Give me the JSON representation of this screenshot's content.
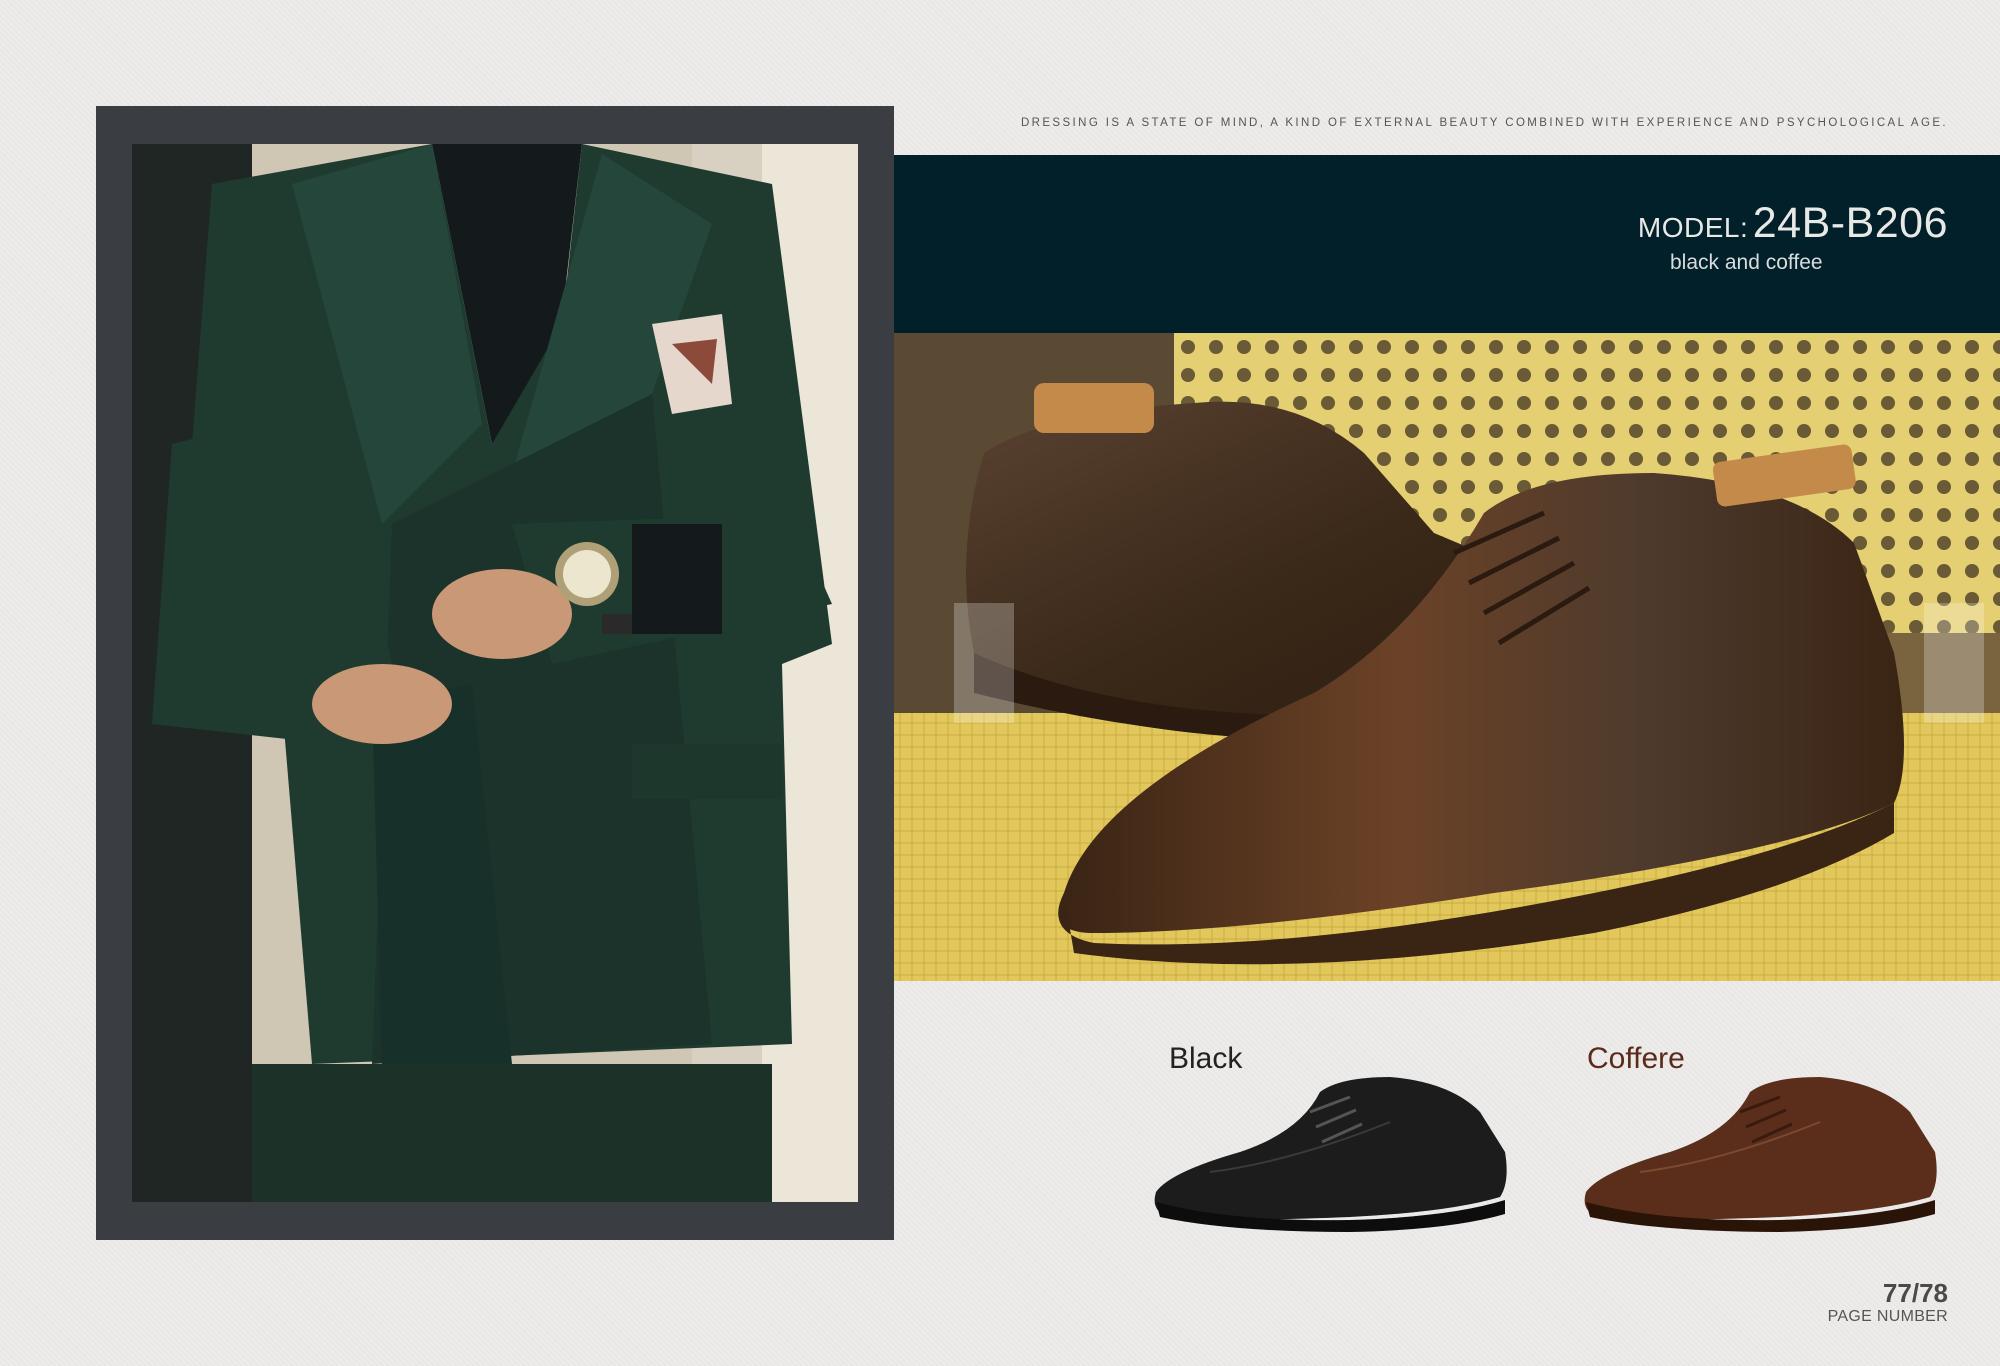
{
  "header": {
    "tagline": "DRESSING IS A STATE OF MIND, A KIND OF EXTERNAL BEAUTY COMBINED WITH EXPERIENCE AND PSYCHOLOGICAL AGE."
  },
  "product": {
    "model_label": "MODEL:",
    "model_code": "24B-B206",
    "color_description": "black and coffee"
  },
  "variants": [
    {
      "label": "Black",
      "color": "#1c1c1c"
    },
    {
      "label": "Coffere",
      "color": "#5a2a1a"
    }
  ],
  "footer": {
    "page_number": "77/78",
    "page_number_label": "PAGE NUMBER"
  },
  "colors": {
    "background": "#ecebea",
    "frame": "#3a3d42",
    "band": "#02202a",
    "suit_green": "#1f3b30"
  }
}
